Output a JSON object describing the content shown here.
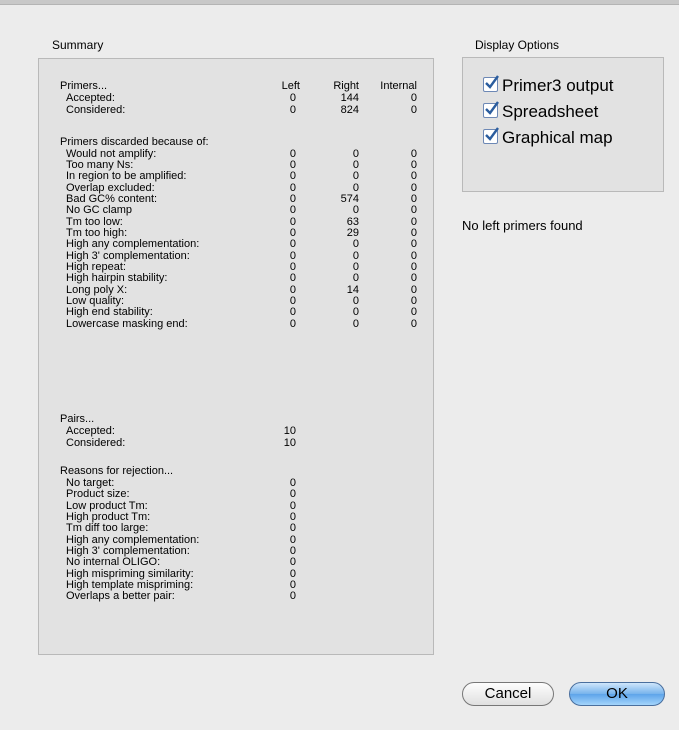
{
  "summary": {
    "title": "Summary",
    "col_left": "Left",
    "col_right": "Right",
    "col_internal": "Internal",
    "primers_header": "Primers...",
    "primers": [
      {
        "label": "Accepted:",
        "left": "0",
        "right": "144",
        "internal": "0"
      },
      {
        "label": "Considered:",
        "left": "0",
        "right": "824",
        "internal": "0"
      }
    ],
    "discarded_header": "Primers discarded because of:",
    "discarded": [
      {
        "label": "Would not amplify:",
        "left": "0",
        "right": "0",
        "internal": "0"
      },
      {
        "label": "Too many Ns:",
        "left": "0",
        "right": "0",
        "internal": "0"
      },
      {
        "label": "In region to be amplified:",
        "left": "0",
        "right": "0",
        "internal": "0"
      },
      {
        "label": "Overlap excluded:",
        "left": "0",
        "right": "0",
        "internal": "0"
      },
      {
        "label": "Bad GC% content:",
        "left": "0",
        "right": "574",
        "internal": "0"
      },
      {
        "label": "No GC clamp",
        "left": "0",
        "right": "0",
        "internal": "0"
      },
      {
        "label": "Tm too low:",
        "left": "0",
        "right": "63",
        "internal": "0"
      },
      {
        "label": "Tm too high:",
        "left": "0",
        "right": "29",
        "internal": "0"
      },
      {
        "label": "High any complementation:",
        "left": "0",
        "right": "0",
        "internal": "0"
      },
      {
        "label": "High 3' complementation:",
        "left": "0",
        "right": "0",
        "internal": "0"
      },
      {
        "label": "High repeat:",
        "left": "0",
        "right": "0",
        "internal": "0"
      },
      {
        "label": "High hairpin stability:",
        "left": "0",
        "right": "0",
        "internal": "0"
      },
      {
        "label": "Long poly X:",
        "left": "0",
        "right": "14",
        "internal": "0"
      },
      {
        "label": "Low quality:",
        "left": "0",
        "right": "0",
        "internal": "0"
      },
      {
        "label": "High end stability:",
        "left": "0",
        "right": "0",
        "internal": "0"
      },
      {
        "label": "Lowercase masking end:",
        "left": "0",
        "right": "0",
        "internal": "0"
      }
    ],
    "pairs_header": "Pairs...",
    "pairs": [
      {
        "label": "Accepted:",
        "value": "10"
      },
      {
        "label": "Considered:",
        "value": "10"
      }
    ],
    "rejection_header": "Reasons for rejection...",
    "rejection": [
      {
        "label": "No target:",
        "value": "0"
      },
      {
        "label": "Product size:",
        "value": "0"
      },
      {
        "label": "Low product Tm:",
        "value": "0"
      },
      {
        "label": "High product Tm:",
        "value": "0"
      },
      {
        "label": "Tm diff too large:",
        "value": "0"
      },
      {
        "label": "High any complementation:",
        "value": "0"
      },
      {
        "label": "High 3' complementation:",
        "value": "0"
      },
      {
        "label": "No internal OLIGO:",
        "value": "0"
      },
      {
        "label": "High mispriming similarity:",
        "value": "0"
      },
      {
        "label": "High template mispriming:",
        "value": "0"
      },
      {
        "label": "Overlaps a better pair:",
        "value": "0"
      }
    ]
  },
  "display_options": {
    "title": "Display Options",
    "options": [
      {
        "label": "Primer3 output",
        "checked": true
      },
      {
        "label": "Spreadsheet",
        "checked": true
      },
      {
        "label": "Graphical map",
        "checked": true
      }
    ]
  },
  "status_message": "No left primers found",
  "buttons": {
    "cancel": "Cancel",
    "ok": "OK"
  },
  "colors": {
    "checkbox_border": "#6d88b5",
    "checkmark": "#2b5d9e",
    "ok_button": "#6aaced"
  }
}
